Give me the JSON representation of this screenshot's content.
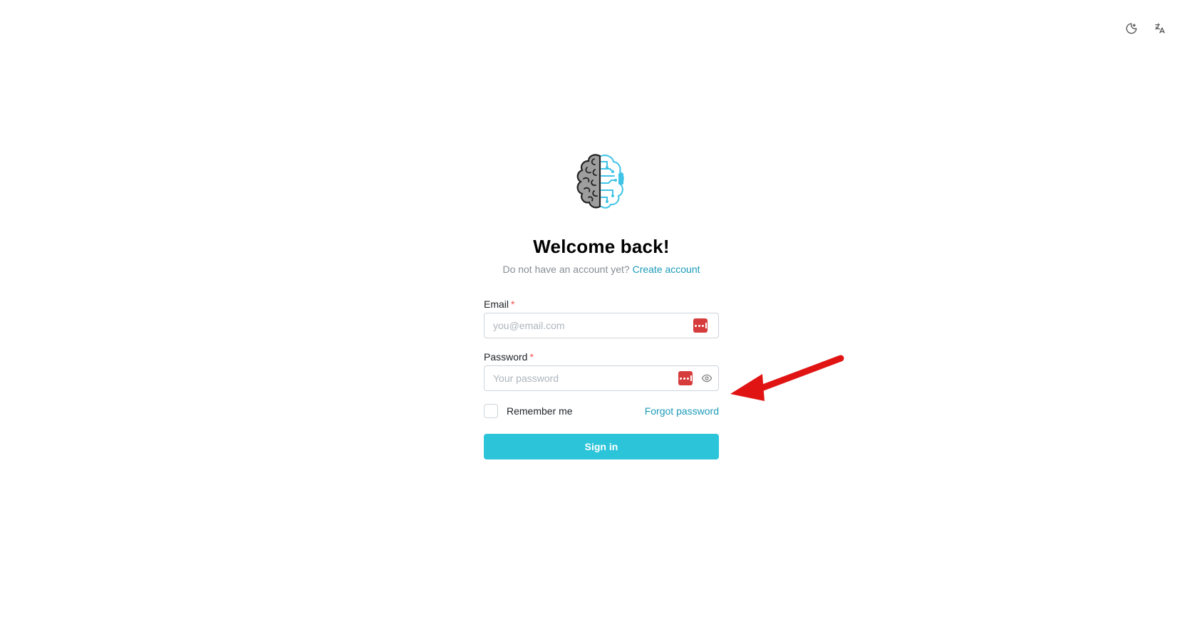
{
  "top_controls": {
    "theme_icon": "moon-icon",
    "language_icon": "translate-icon"
  },
  "header": {
    "logo_icon": "brain-circuit-logo",
    "title": "Welcome back!",
    "subtitle_text": "Do not have an account yet?",
    "create_account_link": "Create account"
  },
  "form": {
    "email_label": "Email",
    "email_required": "*",
    "email_placeholder": "you@email.com",
    "email_value": "",
    "password_label": "Password",
    "password_required": "*",
    "password_placeholder": "Your password",
    "password_value": "",
    "remember_label": "Remember me",
    "remember_checked": false,
    "forgot_link": "Forgot password",
    "submit_label": "Sign in"
  },
  "colors": {
    "accent": "#2bc4d9",
    "link": "#1c9bb8",
    "required": "#fa5252",
    "password_manager": "#d63c3c",
    "annotation_arrow": "#e11414"
  }
}
